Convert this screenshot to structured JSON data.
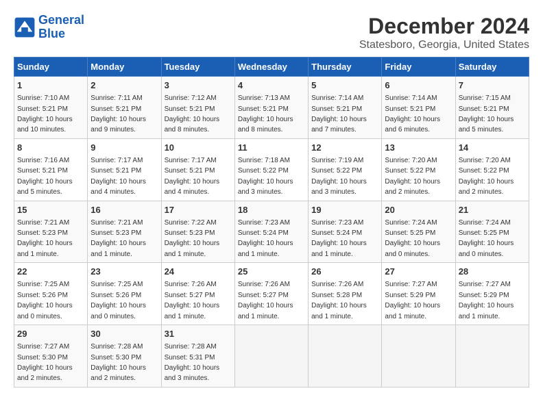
{
  "logo": {
    "line1": "General",
    "line2": "Blue"
  },
  "title": "December 2024",
  "subtitle": "Statesboro, Georgia, United States",
  "header": {
    "colors": {
      "bg": "#1a5fb4",
      "text": "#ffffff"
    }
  },
  "weekdays": [
    "Sunday",
    "Monday",
    "Tuesday",
    "Wednesday",
    "Thursday",
    "Friday",
    "Saturday"
  ],
  "weeks": [
    [
      {
        "day": "1",
        "sunrise": "7:10 AM",
        "sunset": "5:21 PM",
        "daylight": "10 hours and 10 minutes."
      },
      {
        "day": "2",
        "sunrise": "7:11 AM",
        "sunset": "5:21 PM",
        "daylight": "10 hours and 9 minutes."
      },
      {
        "day": "3",
        "sunrise": "7:12 AM",
        "sunset": "5:21 PM",
        "daylight": "10 hours and 8 minutes."
      },
      {
        "day": "4",
        "sunrise": "7:13 AM",
        "sunset": "5:21 PM",
        "daylight": "10 hours and 8 minutes."
      },
      {
        "day": "5",
        "sunrise": "7:14 AM",
        "sunset": "5:21 PM",
        "daylight": "10 hours and 7 minutes."
      },
      {
        "day": "6",
        "sunrise": "7:14 AM",
        "sunset": "5:21 PM",
        "daylight": "10 hours and 6 minutes."
      },
      {
        "day": "7",
        "sunrise": "7:15 AM",
        "sunset": "5:21 PM",
        "daylight": "10 hours and 5 minutes."
      }
    ],
    [
      {
        "day": "8",
        "sunrise": "7:16 AM",
        "sunset": "5:21 PM",
        "daylight": "10 hours and 5 minutes."
      },
      {
        "day": "9",
        "sunrise": "7:17 AM",
        "sunset": "5:21 PM",
        "daylight": "10 hours and 4 minutes."
      },
      {
        "day": "10",
        "sunrise": "7:17 AM",
        "sunset": "5:21 PM",
        "daylight": "10 hours and 4 minutes."
      },
      {
        "day": "11",
        "sunrise": "7:18 AM",
        "sunset": "5:22 PM",
        "daylight": "10 hours and 3 minutes."
      },
      {
        "day": "12",
        "sunrise": "7:19 AM",
        "sunset": "5:22 PM",
        "daylight": "10 hours and 3 minutes."
      },
      {
        "day": "13",
        "sunrise": "7:20 AM",
        "sunset": "5:22 PM",
        "daylight": "10 hours and 2 minutes."
      },
      {
        "day": "14",
        "sunrise": "7:20 AM",
        "sunset": "5:22 PM",
        "daylight": "10 hours and 2 minutes."
      }
    ],
    [
      {
        "day": "15",
        "sunrise": "7:21 AM",
        "sunset": "5:23 PM",
        "daylight": "10 hours and 1 minute."
      },
      {
        "day": "16",
        "sunrise": "7:21 AM",
        "sunset": "5:23 PM",
        "daylight": "10 hours and 1 minute."
      },
      {
        "day": "17",
        "sunrise": "7:22 AM",
        "sunset": "5:23 PM",
        "daylight": "10 hours and 1 minute."
      },
      {
        "day": "18",
        "sunrise": "7:23 AM",
        "sunset": "5:24 PM",
        "daylight": "10 hours and 1 minute."
      },
      {
        "day": "19",
        "sunrise": "7:23 AM",
        "sunset": "5:24 PM",
        "daylight": "10 hours and 1 minute."
      },
      {
        "day": "20",
        "sunrise": "7:24 AM",
        "sunset": "5:25 PM",
        "daylight": "10 hours and 0 minutes."
      },
      {
        "day": "21",
        "sunrise": "7:24 AM",
        "sunset": "5:25 PM",
        "daylight": "10 hours and 0 minutes."
      }
    ],
    [
      {
        "day": "22",
        "sunrise": "7:25 AM",
        "sunset": "5:26 PM",
        "daylight": "10 hours and 0 minutes."
      },
      {
        "day": "23",
        "sunrise": "7:25 AM",
        "sunset": "5:26 PM",
        "daylight": "10 hours and 0 minutes."
      },
      {
        "day": "24",
        "sunrise": "7:26 AM",
        "sunset": "5:27 PM",
        "daylight": "10 hours and 1 minute."
      },
      {
        "day": "25",
        "sunrise": "7:26 AM",
        "sunset": "5:27 PM",
        "daylight": "10 hours and 1 minute."
      },
      {
        "day": "26",
        "sunrise": "7:26 AM",
        "sunset": "5:28 PM",
        "daylight": "10 hours and 1 minute."
      },
      {
        "day": "27",
        "sunrise": "7:27 AM",
        "sunset": "5:29 PM",
        "daylight": "10 hours and 1 minute."
      },
      {
        "day": "28",
        "sunrise": "7:27 AM",
        "sunset": "5:29 PM",
        "daylight": "10 hours and 1 minute."
      }
    ],
    [
      {
        "day": "29",
        "sunrise": "7:27 AM",
        "sunset": "5:30 PM",
        "daylight": "10 hours and 2 minutes."
      },
      {
        "day": "30",
        "sunrise": "7:28 AM",
        "sunset": "5:30 PM",
        "daylight": "10 hours and 2 minutes."
      },
      {
        "day": "31",
        "sunrise": "7:28 AM",
        "sunset": "5:31 PM",
        "daylight": "10 hours and 3 minutes."
      },
      null,
      null,
      null,
      null
    ]
  ]
}
